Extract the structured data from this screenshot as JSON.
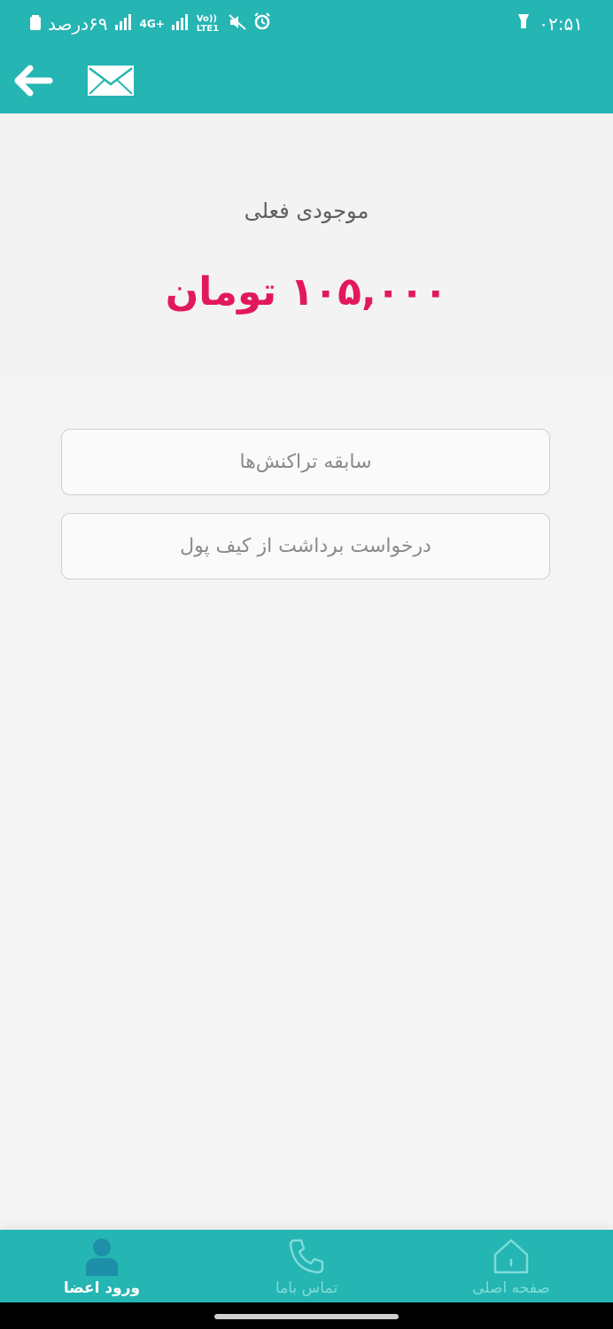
{
  "status_bar": {
    "time": "۰۲:۵۱",
    "battery": "۶۹درصد",
    "network_4g": "4G+",
    "volte": "Vo)) LTE1",
    "icons": [
      "flashlight-icon",
      "alarm-icon",
      "mute-icon",
      "signal-icon",
      "battery-icon"
    ]
  },
  "app_bar": {
    "icons": [
      "back-arrow-icon",
      "mail-icon"
    ]
  },
  "balance": {
    "label": "موجودی فعلی",
    "amount": "۱۰۵,۰۰۰ تومان"
  },
  "actions": {
    "history_label": "سابقه تراکنش‌ها",
    "withdraw_label": "درخواست برداشت از کیف پول"
  },
  "bottom_nav": {
    "login_label": "ورود اعضا",
    "contact_label": "تماس باما",
    "home_label": "صفحه اصلی",
    "icons": [
      "user-icon",
      "phone-icon",
      "home-icon"
    ]
  },
  "colors": {
    "primary": "#25b5b3",
    "amount": "#e2185f",
    "background": "#f3f3f3",
    "nav_active": "#ffffff",
    "nav_inactive": "#7fdcd8"
  }
}
